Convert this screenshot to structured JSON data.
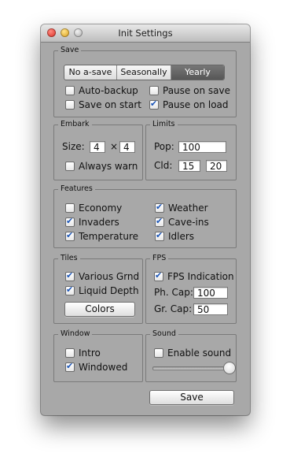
{
  "window": {
    "title": "Init Settings"
  },
  "save": {
    "label": "Save",
    "segments": [
      {
        "label": "No a-save",
        "selected": false
      },
      {
        "label": "Seasonally",
        "selected": false
      },
      {
        "label": "Yearly",
        "selected": true
      }
    ],
    "checks": [
      {
        "label": "Auto-backup",
        "checked": false
      },
      {
        "label": "Pause on save",
        "checked": false
      },
      {
        "label": "Save on start",
        "checked": false
      },
      {
        "label": "Pause on load",
        "checked": true
      }
    ]
  },
  "embark": {
    "label": "Embark",
    "size_label": "Size:",
    "size_x": "4",
    "times": "×",
    "size_y": "4",
    "always_warn": {
      "label": "Always warn",
      "checked": false
    }
  },
  "limits": {
    "label": "Limits",
    "pop_label": "Pop:",
    "pop_value": "100",
    "cld_label": "Cld:",
    "cld_value_1": "15",
    "cld_value_2": "20"
  },
  "features": {
    "label": "Features",
    "items": [
      {
        "label": "Economy",
        "checked": false
      },
      {
        "label": "Weather",
        "checked": true
      },
      {
        "label": "Invaders",
        "checked": true
      },
      {
        "label": "Cave-ins",
        "checked": true
      },
      {
        "label": "Temperature",
        "checked": true
      },
      {
        "label": "Idlers",
        "checked": true
      }
    ]
  },
  "tiles": {
    "label": "Tiles",
    "items": [
      {
        "label": "Various Grnd",
        "checked": true
      },
      {
        "label": "Liquid Depth",
        "checked": true
      }
    ],
    "colors_button": "Colors"
  },
  "fps": {
    "label": "FPS",
    "indication": {
      "label": "FPS Indication",
      "checked": true
    },
    "ph_cap_label": "Ph. Cap:",
    "ph_cap_value": "100",
    "gr_cap_label": "Gr. Cap:",
    "gr_cap_value": "50"
  },
  "window_group": {
    "label": "Window",
    "items": [
      {
        "label": "Intro",
        "checked": false
      },
      {
        "label": "Windowed",
        "checked": true
      }
    ]
  },
  "sound": {
    "label": "Sound",
    "enable": {
      "label": "Enable sound",
      "checked": false
    },
    "volume": 1.0
  },
  "footer": {
    "save_button": "Save"
  }
}
